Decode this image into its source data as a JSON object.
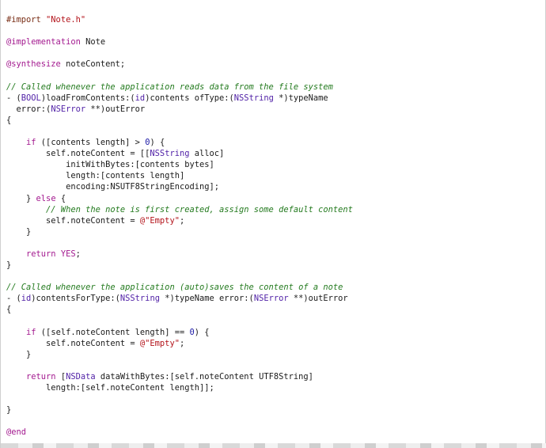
{
  "lines": [
    {
      "tokens": [
        {
          "t": "#import ",
          "c": "dir"
        },
        {
          "t": "\"Note.h\"",
          "c": "str"
        }
      ]
    },
    {
      "tokens": []
    },
    {
      "tokens": [
        {
          "t": "@implementation",
          "c": "kw"
        },
        {
          "t": " Note",
          "c": ""
        }
      ]
    },
    {
      "tokens": []
    },
    {
      "tokens": [
        {
          "t": "@synthesize",
          "c": "kw"
        },
        {
          "t": " noteContent;",
          "c": ""
        }
      ]
    },
    {
      "tokens": []
    },
    {
      "tokens": [
        {
          "t": "// Called whenever the application reads data from the file system",
          "c": "cmt"
        }
      ]
    },
    {
      "tokens": [
        {
          "t": "- (",
          "c": ""
        },
        {
          "t": "BOOL",
          "c": "ty"
        },
        {
          "t": ")loadFromContents:(",
          "c": ""
        },
        {
          "t": "id",
          "c": "ty"
        },
        {
          "t": ")contents ofType:(",
          "c": ""
        },
        {
          "t": "NSString",
          "c": "ty"
        },
        {
          "t": " *)typeName",
          "c": ""
        }
      ]
    },
    {
      "tokens": [
        {
          "t": "  error:(",
          "c": ""
        },
        {
          "t": "NSError",
          "c": "ty"
        },
        {
          "t": " **)outError",
          "c": ""
        }
      ]
    },
    {
      "tokens": [
        {
          "t": "{",
          "c": ""
        }
      ]
    },
    {
      "tokens": []
    },
    {
      "tokens": [
        {
          "t": "    ",
          "c": ""
        },
        {
          "t": "if",
          "c": "kw"
        },
        {
          "t": " ([contents length] > ",
          "c": ""
        },
        {
          "t": "0",
          "c": "num"
        },
        {
          "t": ") {",
          "c": ""
        }
      ]
    },
    {
      "tokens": [
        {
          "t": "        self.noteContent = [[",
          "c": ""
        },
        {
          "t": "NSString",
          "c": "ty"
        },
        {
          "t": " alloc]",
          "c": ""
        }
      ]
    },
    {
      "tokens": [
        {
          "t": "            initWithBytes:[contents bytes]",
          "c": ""
        }
      ]
    },
    {
      "tokens": [
        {
          "t": "            length:[contents length]",
          "c": ""
        }
      ]
    },
    {
      "tokens": [
        {
          "t": "            encoding:NSUTF8StringEncoding];",
          "c": ""
        }
      ]
    },
    {
      "tokens": [
        {
          "t": "    } ",
          "c": ""
        },
        {
          "t": "else",
          "c": "kw"
        },
        {
          "t": " {",
          "c": ""
        }
      ]
    },
    {
      "tokens": [
        {
          "t": "        ",
          "c": ""
        },
        {
          "t": "// When the note is first created, assign some default content",
          "c": "cmt"
        }
      ]
    },
    {
      "tokens": [
        {
          "t": "        self.noteContent = ",
          "c": ""
        },
        {
          "t": "@\"Empty\"",
          "c": "str"
        },
        {
          "t": ";",
          "c": ""
        }
      ]
    },
    {
      "tokens": [
        {
          "t": "    }",
          "c": ""
        }
      ]
    },
    {
      "tokens": []
    },
    {
      "tokens": [
        {
          "t": "    ",
          "c": ""
        },
        {
          "t": "return",
          "c": "kw"
        },
        {
          "t": " ",
          "c": ""
        },
        {
          "t": "YES",
          "c": "kw"
        },
        {
          "t": ";",
          "c": ""
        }
      ]
    },
    {
      "tokens": [
        {
          "t": "}",
          "c": ""
        }
      ]
    },
    {
      "tokens": []
    },
    {
      "tokens": [
        {
          "t": "// Called whenever the application (auto)saves the content of a note",
          "c": "cmt"
        }
      ]
    },
    {
      "tokens": [
        {
          "t": "- (",
          "c": ""
        },
        {
          "t": "id",
          "c": "ty"
        },
        {
          "t": ")contentsForType:(",
          "c": ""
        },
        {
          "t": "NSString",
          "c": "ty"
        },
        {
          "t": " *)typeName error:(",
          "c": ""
        },
        {
          "t": "NSError",
          "c": "ty"
        },
        {
          "t": " **)outError",
          "c": ""
        }
      ]
    },
    {
      "tokens": [
        {
          "t": "{",
          "c": ""
        }
      ]
    },
    {
      "tokens": []
    },
    {
      "tokens": [
        {
          "t": "    ",
          "c": ""
        },
        {
          "t": "if",
          "c": "kw"
        },
        {
          "t": " ([self.noteContent length] == ",
          "c": ""
        },
        {
          "t": "0",
          "c": "num"
        },
        {
          "t": ") {",
          "c": ""
        }
      ]
    },
    {
      "tokens": [
        {
          "t": "        self.noteContent = ",
          "c": ""
        },
        {
          "t": "@\"Empty\"",
          "c": "str"
        },
        {
          "t": ";",
          "c": ""
        }
      ]
    },
    {
      "tokens": [
        {
          "t": "    }",
          "c": ""
        }
      ]
    },
    {
      "tokens": []
    },
    {
      "tokens": [
        {
          "t": "    ",
          "c": ""
        },
        {
          "t": "return",
          "c": "kw"
        },
        {
          "t": " [",
          "c": ""
        },
        {
          "t": "NSData",
          "c": "ty"
        },
        {
          "t": " dataWithBytes:[self.noteContent UTF8String]",
          "c": ""
        }
      ]
    },
    {
      "tokens": [
        {
          "t": "        length:[self.noteContent length]];",
          "c": ""
        }
      ]
    },
    {
      "tokens": []
    },
    {
      "tokens": [
        {
          "t": "}",
          "c": ""
        }
      ]
    },
    {
      "tokens": []
    },
    {
      "tokens": [
        {
          "t": "@end",
          "c": "kw"
        }
      ]
    }
  ],
  "colors": {
    "directive": "#7a2f17",
    "string": "#b3131a",
    "keyword": "#a3198f",
    "type": "#4f1fa6",
    "comment": "#237a1e",
    "number": "#1c1aa6"
  }
}
